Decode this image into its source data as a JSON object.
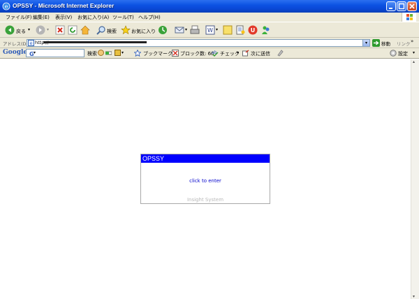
{
  "window": {
    "title": "OPSSY - Microsoft Internet Explorer"
  },
  "menu": [
    "ファイル(F)",
    "編集(E)",
    "表示(V)",
    "お気に入り(A)",
    "ツール(T)",
    "ヘルプ(H)"
  ],
  "toolbar": {
    "back_label": "戻る",
    "search_label": "検索",
    "favorites_label": "お気に入り"
  },
  "address": {
    "label": "アドレス(D)",
    "url": "http://",
    "go_label": "移動",
    "links_label": "リンク"
  },
  "google_bar": {
    "logo": "Google",
    "search_label": "検索",
    "bookmarks_label": "ブックマーク",
    "blocked_label": "ブロック数: 60",
    "check_label": "チェック",
    "send_label": "次に送信",
    "settings_label": "設定"
  },
  "page": {
    "dialog_title": "OPSSY",
    "enter_link": "click to enter",
    "footer": "Insight System"
  },
  "colors": {
    "titlebar": "#0a48d6",
    "dialog_header": "#0000ff",
    "link": "#0000cc"
  }
}
